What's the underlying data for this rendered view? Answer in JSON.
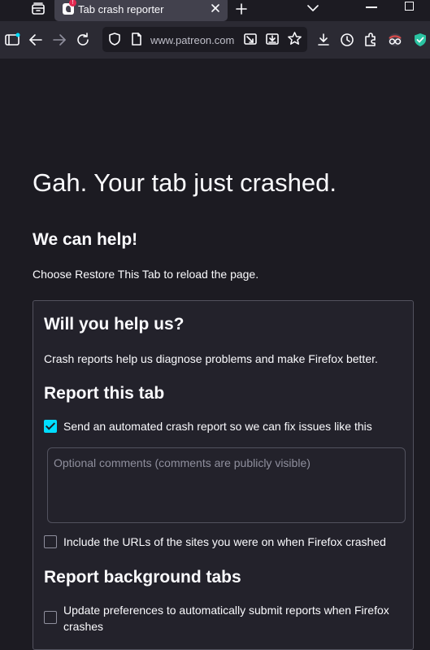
{
  "tab": {
    "title": "Tab crash reporter",
    "badge": "!"
  },
  "navbar": {
    "url": "www.patreon.com"
  },
  "page": {
    "heading": "Gah. Your tab just crashed.",
    "subheading": "We can help!",
    "lead": "Choose Restore This Tab to reload the page."
  },
  "panel": {
    "heading": "Will you help us?",
    "description": "Crash reports help us diagnose problems and make Firefox better.",
    "report_tab_heading": "Report this tab",
    "send_report_label": "Send an automated crash report so we can fix issues like this",
    "send_report_checked": true,
    "comments_placeholder": "Optional comments (comments are publicly visible)",
    "comments_value": "",
    "include_urls_label": "Include the URLs of the sites you were on when Firefox crashed",
    "include_urls_checked": false,
    "background_heading": "Report background tabs",
    "auto_submit_label_line1": "Update preferences to automatically submit reports when Firefox",
    "auto_submit_label_line2": "crashes",
    "auto_submit_checked": false
  },
  "colors": {
    "accent": "#00ddff",
    "background": "#1c1b22",
    "toolbar": "#2b2a33",
    "active_tab": "#42414d",
    "shield_green": "#2ac3a2"
  },
  "icons": [
    "tab-list-icon",
    "favicon-icon",
    "close-icon",
    "plus-icon",
    "chevron-down-icon",
    "minimize-icon",
    "maximize-icon",
    "sidebar-icon",
    "back-arrow-icon",
    "forward-arrow-icon",
    "reload-icon",
    "shield-icon",
    "page-icon",
    "picture-in-picture-icon",
    "save-icon",
    "star-icon",
    "download-icon",
    "history-icon",
    "extensions-icon",
    "glasses-extension-icon",
    "green-shield-extension-icon"
  ]
}
